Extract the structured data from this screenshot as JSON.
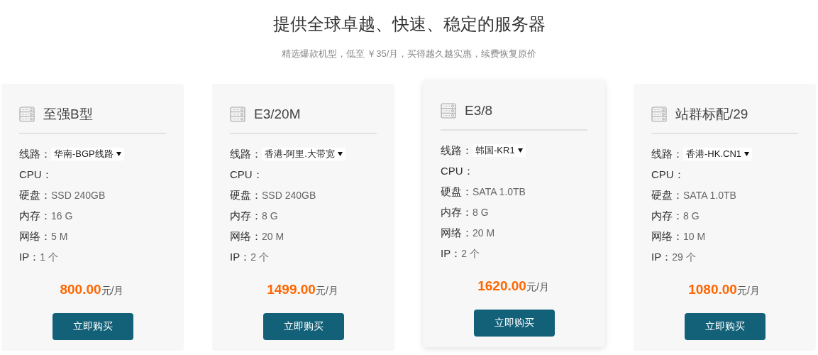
{
  "header": {
    "title": "提供全球卓越、快速、稳定的服务器",
    "subtitle": "精选爆款机型，低至 ￥35/月，买得越久越实惠，续费恢复原价"
  },
  "plans": [
    {
      "name": "至强B型",
      "raised": false,
      "line_label": "线路：",
      "line_value": "华南-BGP线路",
      "specs": [
        {
          "label": "CPU："
        },
        {
          "label": "硬盘：",
          "value": "SSD 240GB"
        },
        {
          "label": "内存：",
          "value": "16 G"
        },
        {
          "label": "网络：",
          "value": "5 M"
        },
        {
          "label": "IP：",
          "value": "1 个"
        }
      ],
      "price": "800.00",
      "unit": "元/月",
      "button": "立即购买"
    },
    {
      "name": "E3/20M",
      "raised": false,
      "line_label": "线路：",
      "line_value": "香港-阿里.大带宽",
      "specs": [
        {
          "label": "CPU："
        },
        {
          "label": "硬盘：",
          "value": "SSD 240GB"
        },
        {
          "label": "内存：",
          "value": "8 G"
        },
        {
          "label": "网络：",
          "value": "20 M"
        },
        {
          "label": "IP：",
          "value": "2 个"
        }
      ],
      "price": "1499.00",
      "unit": "元/月",
      "button": "立即购买"
    },
    {
      "name": "E3/8",
      "raised": true,
      "line_label": "线路：",
      "line_value": "韩国-KR1",
      "specs": [
        {
          "label": "CPU："
        },
        {
          "label": "硬盘：",
          "value": "SATA 1.0TB"
        },
        {
          "label": "内存：",
          "value": "8 G"
        },
        {
          "label": "网络：",
          "value": "20 M"
        },
        {
          "label": "IP：",
          "value": "2 个"
        }
      ],
      "price": "1620.00",
      "unit": "元/月",
      "button": "立即购买"
    },
    {
      "name": "站群标配/29",
      "raised": false,
      "line_label": "线路：",
      "line_value": "香港-HK.CN1",
      "specs": [
        {
          "label": "CPU："
        },
        {
          "label": "硬盘：",
          "value": "SATA 1.0TB"
        },
        {
          "label": "内存：",
          "value": "8 G"
        },
        {
          "label": "网络：",
          "value": "10 M"
        },
        {
          "label": "IP：",
          "value": "29 个"
        }
      ],
      "price": "1080.00",
      "unit": "元/月",
      "button": "立即购买"
    }
  ]
}
